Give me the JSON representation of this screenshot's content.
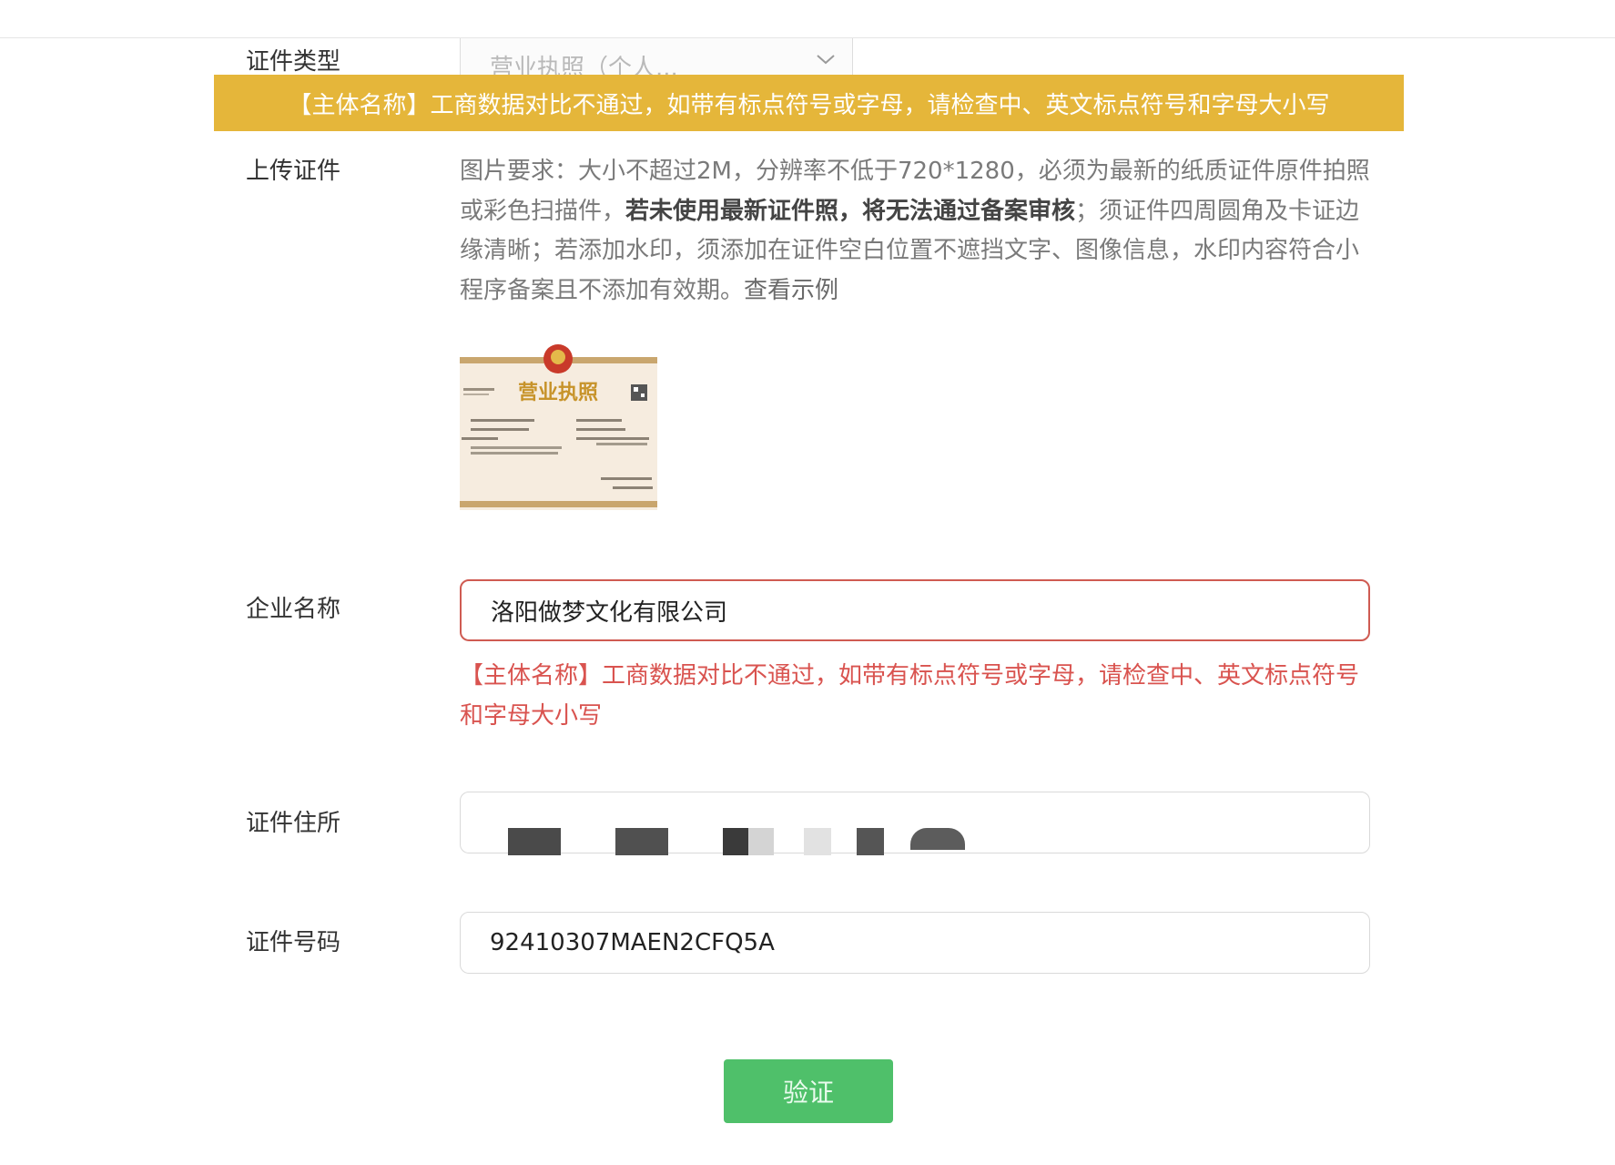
{
  "form": {
    "cert_type": {
      "label": "证件类型",
      "selected_value": "营业执照（个人..."
    },
    "banner_error": "【主体名称】工商数据对比不通过，如带有标点符号或字母，请检查中、英文标点符号和字母大小写",
    "upload": {
      "label": "上传证件",
      "desc_part1": "图片要求：大小不超过2M，分辨率不低于720*1280，必须为最新的纸质证件原件拍照或彩色扫描件，",
      "desc_bold": "若未使用最新证件照，将无法通过备案审核",
      "desc_part2": "；须证件四周圆角及卡证边缘清晰；若添加水印，须添加在证件空白位置不遮挡文字、图像信息，水印内容符合小程序备案且不添加有效期。",
      "example_link": "查看示例",
      "thumbnail_title": "营业执照"
    },
    "company_name": {
      "label": "企业名称",
      "value": "洛阳做梦文化有限公司",
      "error": "【主体名称】工商数据对比不通过，如带有标点符号或字母，请检查中、英文标点符号和字母大小写"
    },
    "address": {
      "label": "证件住所",
      "value": ""
    },
    "cert_number": {
      "label": "证件号码",
      "value": "92410307MAEN2CFQ5A"
    },
    "verify_button": "验证"
  },
  "colors": {
    "banner": "#e5b63a",
    "error": "#d9534f",
    "button": "#4fc06a"
  },
  "icons": {
    "select_arrow": "chevron-down-icon",
    "thumbnail_emblem": "national-emblem-icon"
  }
}
